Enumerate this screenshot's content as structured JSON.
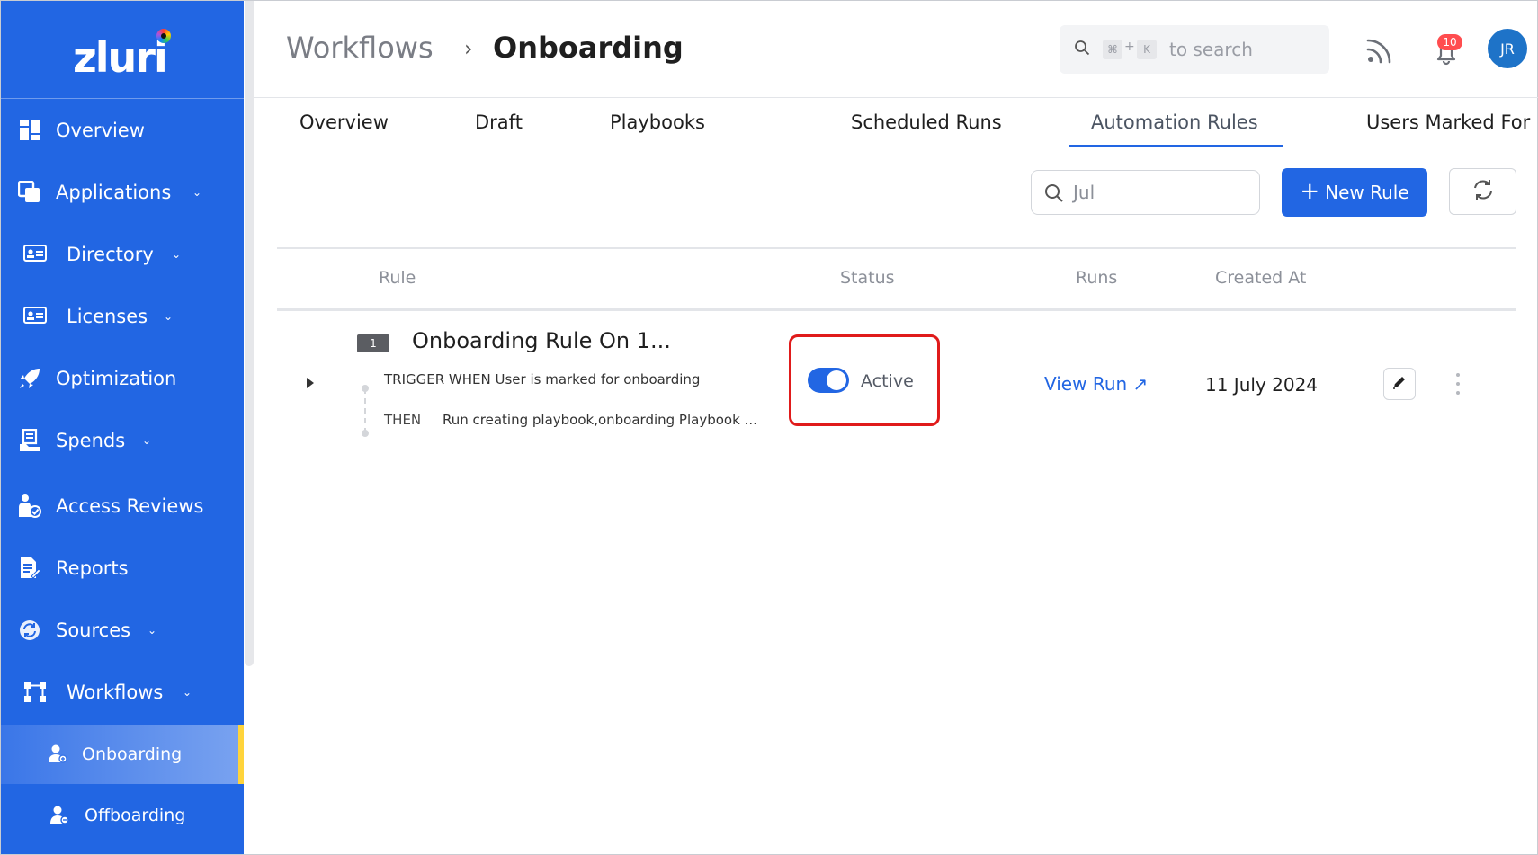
{
  "brand": {
    "logo_text": "zluri"
  },
  "colors": {
    "primary": "#2266e3",
    "sidebar_bg": "#2266e3",
    "active_accent": "#ffd43b",
    "highlight_box": "#e01b1b",
    "badge": "#ff4d4f"
  },
  "sidebar": {
    "items": [
      {
        "label": "Overview",
        "icon": "grid-icon",
        "has_chevron": false
      },
      {
        "label": "Applications",
        "icon": "windows-icon",
        "has_chevron": true
      },
      {
        "label": "Directory",
        "icon": "id-card-icon",
        "has_chevron": true
      },
      {
        "label": "Licenses",
        "icon": "id-card-icon",
        "has_chevron": true
      },
      {
        "label": "Optimization",
        "icon": "rocket-icon",
        "has_chevron": false
      },
      {
        "label": "Spends",
        "icon": "receipt-icon",
        "has_chevron": true
      },
      {
        "label": "Access Reviews",
        "icon": "user-check-icon",
        "has_chevron": false
      },
      {
        "label": "Reports",
        "icon": "report-icon",
        "has_chevron": false
      },
      {
        "label": "Sources",
        "icon": "sync-icon",
        "has_chevron": true
      },
      {
        "label": "Workflows",
        "icon": "workflow-icon",
        "has_chevron": true
      }
    ],
    "sub_items": [
      {
        "label": "Onboarding",
        "active": true
      },
      {
        "label": "Offboarding",
        "active": false
      }
    ]
  },
  "header": {
    "breadcrumb_parent": "Workflows",
    "breadcrumb_separator": "›",
    "breadcrumb_current": "Onboarding",
    "search": {
      "shortcut_key1": "⌘",
      "shortcut_plus": "+",
      "shortcut_key2": "K",
      "placeholder": "to search"
    },
    "notifications_count": "10",
    "avatar_initials": "JR"
  },
  "tabs": [
    {
      "label": "Overview",
      "active": false
    },
    {
      "label": "Draft",
      "active": false
    },
    {
      "label": "Playbooks",
      "active": false
    },
    {
      "label": "Scheduled Runs",
      "active": false
    },
    {
      "label": "Automation Rules",
      "active": true
    },
    {
      "label": "Users Marked For",
      "active": false
    }
  ],
  "toolbar": {
    "search_value": "Jul",
    "new_rule_plus": "+",
    "new_rule_label": "New Rule"
  },
  "table": {
    "columns": [
      "Rule",
      "Status",
      "Runs",
      "Created At"
    ],
    "rows": [
      {
        "index": "1",
        "title": "Onboarding Rule On 1...",
        "trigger": "TRIGGER WHEN User is marked for onboarding",
        "then_keyword": "THEN",
        "then_text": "Run creating playbook,onboarding Playbook ...",
        "status": "Active",
        "status_on": true,
        "runs_link": "View Run ↗",
        "created_at": "11 July 2024"
      }
    ]
  }
}
